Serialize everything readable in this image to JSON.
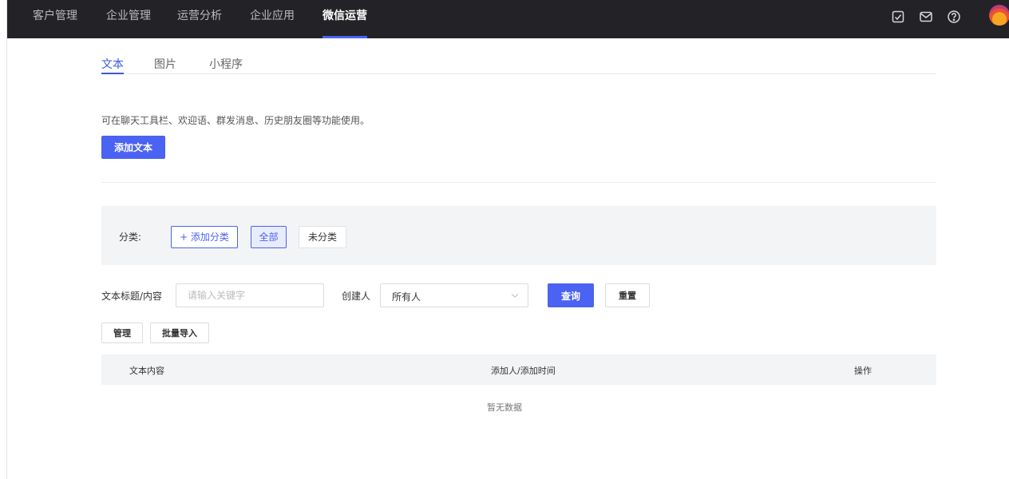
{
  "topnav": {
    "items": [
      "客户管理",
      "企业管理",
      "运营分析",
      "企业应用",
      "微信运营"
    ],
    "active_index": 4,
    "icons": [
      "check-square-icon",
      "mail-icon",
      "help-icon"
    ],
    "accent": "#4a63f2",
    "background": "#232327"
  },
  "tabs": [
    "文本",
    "图片",
    "小程序"
  ],
  "hint": "可在聊天工具栏、欢迎语、群发消息、历史朋友圈等功能使用。",
  "add_text_button": "添加文本",
  "category": {
    "label": "分类:",
    "add_button": "+ 添加分类",
    "all": "全部",
    "uncategorized": "未分类"
  },
  "filter": {
    "title_label": "文本标题/内容",
    "title_placeholder": "请输入关键字",
    "creator_label": "创建人",
    "creator_value": "所有人",
    "query_button": "查询",
    "reset_button": "重置"
  },
  "actions": {
    "manage": "管理",
    "batch_import": "批量导入"
  },
  "table": {
    "columns": [
      "文本内容",
      "添加人/添加时间",
      "操作"
    ],
    "empty_text": "暂无数据"
  }
}
